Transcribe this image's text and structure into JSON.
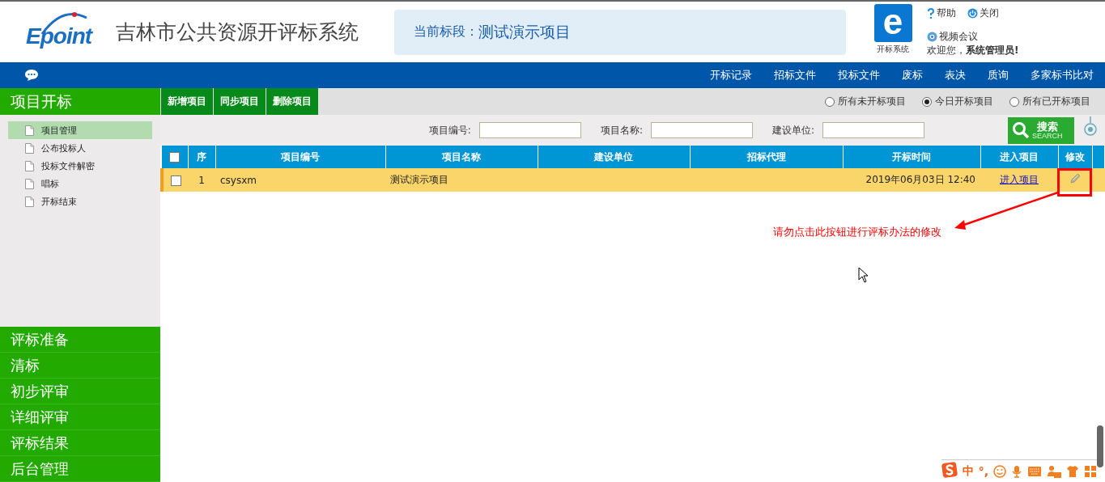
{
  "header": {
    "logo": "Epoint",
    "system_title": "吉林市公共资源开评标系统",
    "current_section": {
      "label": "当前标段：",
      "value": "测试演示项目"
    },
    "app": {
      "glyph": "e",
      "label": "开标系统"
    },
    "links": [
      "帮助",
      "关闭"
    ],
    "video": "视频会议",
    "welcome": "欢迎您，**系统管理员!**"
  },
  "nav": [
    "开标记录",
    "招标文件",
    "投标文件",
    "废标",
    "表决",
    "质询",
    "多家标书比对"
  ],
  "sidebar": {
    "title": "项目开标",
    "items": [
      {
        "label": "项目管理",
        "selected": true
      },
      {
        "label": "公布投标人",
        "selected": false
      },
      {
        "label": "投标文件解密",
        "selected": false
      },
      {
        "label": "唱标",
        "selected": false
      },
      {
        "label": "开标结束",
        "selected": false
      }
    ],
    "sections": [
      "评标准备",
      "清标",
      "初步评审",
      "详细评审",
      "评标结果",
      "后台管理"
    ]
  },
  "toolbar": {
    "buttons": [
      "新增项目",
      "同步项目",
      "删除项目"
    ],
    "filters": [
      {
        "label": "所有未开标项目",
        "selected": false
      },
      {
        "label": "今日开标项目",
        "selected": true
      },
      {
        "label": "所有已开标项目",
        "selected": false
      }
    ]
  },
  "search": {
    "fields": [
      {
        "label": "项目编号:"
      },
      {
        "label": "项目名称:"
      },
      {
        "label": "建设单位:"
      }
    ],
    "button": "搜索",
    "button_sub": "SEARCH"
  },
  "table": {
    "all_checked": false,
    "columns": [
      "序",
      "项目编号",
      "项目名称",
      "建设单位",
      "招标代理",
      "开标时间",
      "进入项目",
      "修改"
    ],
    "rows": [
      {
        "checked": false,
        "selected": true,
        "index": "1",
        "code": "csysxm",
        "name": "测试演示项目",
        "unit": "",
        "agent": "",
        "open_time": "2019年06月03日 12:40",
        "enter": "进入项目"
      }
    ]
  },
  "annotation": "请勿点击此按钮进行评标办法的修改",
  "ime": {
    "lang": "中",
    "punct": "°,"
  }
}
